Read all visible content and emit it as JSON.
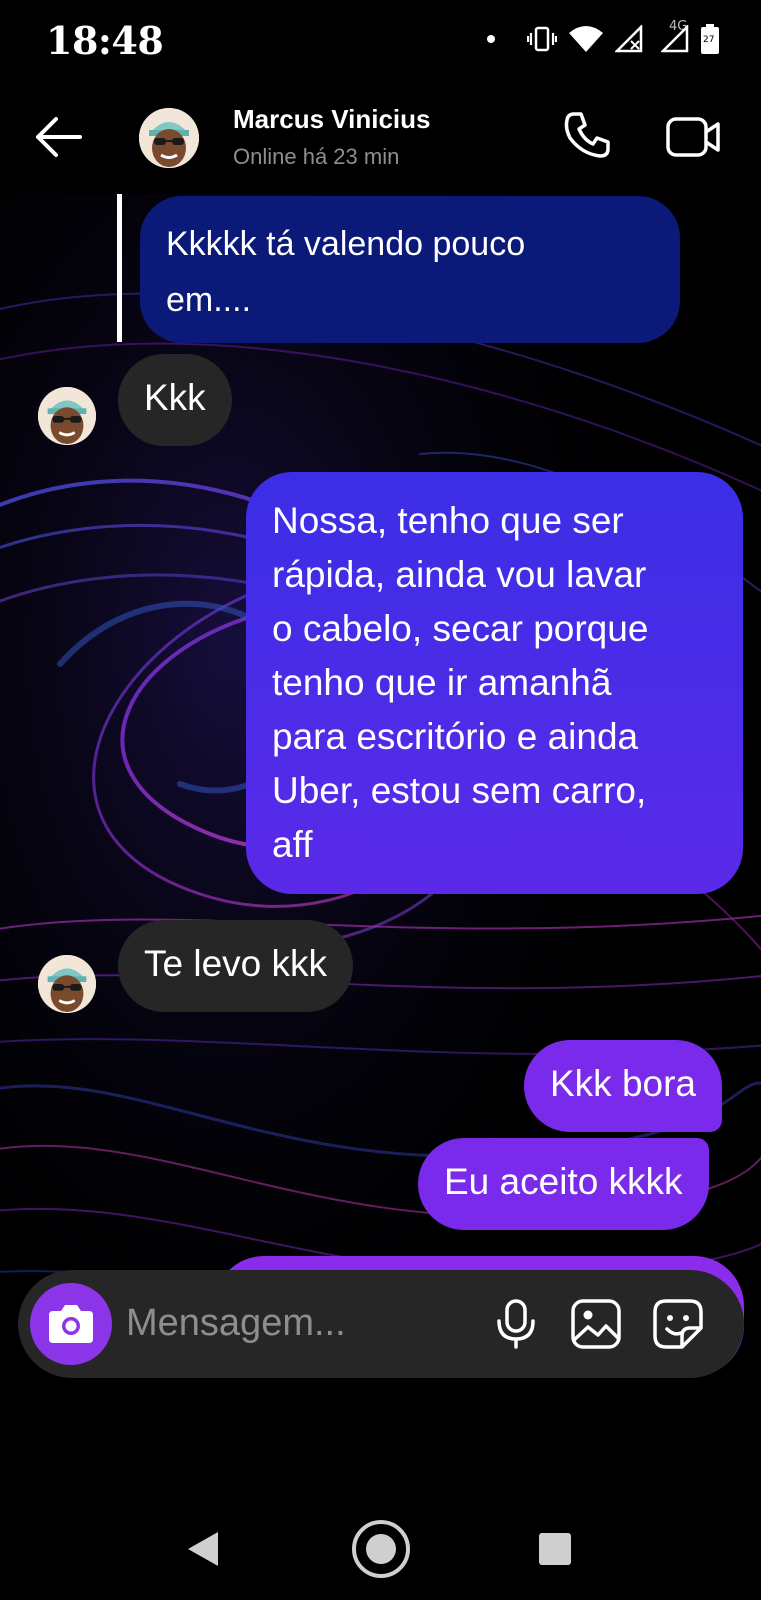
{
  "status_bar": {
    "time": "18:48",
    "network_label": "4G",
    "battery_label": "27"
  },
  "header": {
    "contact_name": "Marcus Vinicius",
    "contact_status": "Online há 23 min",
    "icons": [
      "back-arrow-icon",
      "phone-icon",
      "video-camera-icon"
    ]
  },
  "messages": [
    {
      "direction": "sent",
      "quoted": true,
      "lines": [
        "Kkkkk tá valendo pouco",
        "em...."
      ]
    },
    {
      "direction": "received",
      "lines": [
        "Kkk"
      ]
    },
    {
      "direction": "sent",
      "lines": [
        "Nossa, tenho que ser",
        "rápida, ainda vou lavar",
        "o cabelo, secar porque",
        "tenho que ir amanhã",
        "para escritório e ainda",
        "Uber, estou sem carro,",
        "aff"
      ]
    },
    {
      "direction": "received",
      "lines": [
        "Te levo kkk"
      ]
    },
    {
      "direction": "sent",
      "lines": [
        "Kkk bora"
      ]
    },
    {
      "direction": "sent",
      "lines": [
        "Eu aceito kkkk"
      ]
    }
  ],
  "composer": {
    "placeholder": "Mensagem...",
    "icons": [
      "camera-icon",
      "microphone-icon",
      "gallery-icon",
      "sticker-icon"
    ]
  },
  "colors": {
    "quoted_bubble": "#0b1a78",
    "received_bubble": "#262626",
    "sent_gradient_top": "#3b2ee6",
    "sent_gradient_bottom": "#7a2aea",
    "camera_button": "#8b34e8"
  }
}
